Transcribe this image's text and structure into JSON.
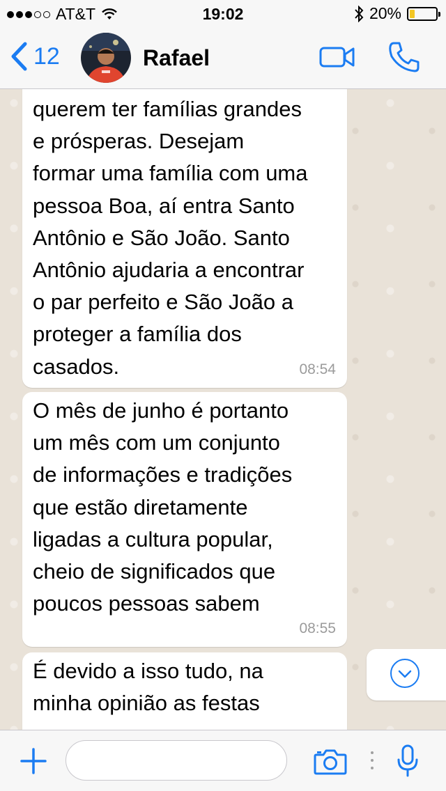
{
  "status_bar": {
    "carrier": "AT&T",
    "time": "19:02",
    "battery_text": "20%",
    "battery_level": 0.2,
    "signal_bars_filled": 3,
    "signal_bars_total": 5
  },
  "header": {
    "back_count": "12",
    "contact_name": "Rafael",
    "icons": [
      "chevron-left-icon",
      "video-call-icon",
      "phone-icon"
    ]
  },
  "messages": [
    {
      "text": "querem ter famílias grandes\ne prósperas. Desejam\nformar uma família com uma\npessoa Boa, aí entra Santo\nAntônio e São João. Santo\nAntônio ajudaria a encontrar\no par perfeito e São João a\nproteger a família dos\ncasados.",
      "time": "08:54"
    },
    {
      "text": "O mês de junho é portanto\num mês com um conjunto\nde informações e tradições\nque estão diretamente\nligadas a cultura popular,\ncheio de significados que\npoucos pessoas sabem",
      "time": "08:55"
    },
    {
      "text": "É devido a isso tudo, na\nminha opinião as festas",
      "time": ""
    }
  ],
  "input": {
    "value": "",
    "placeholder": ""
  },
  "colors": {
    "accent": "#1b7cf2",
    "chat_background": "#e9e2d8",
    "bubble": "#ffffff",
    "battery": "#f3c623"
  }
}
